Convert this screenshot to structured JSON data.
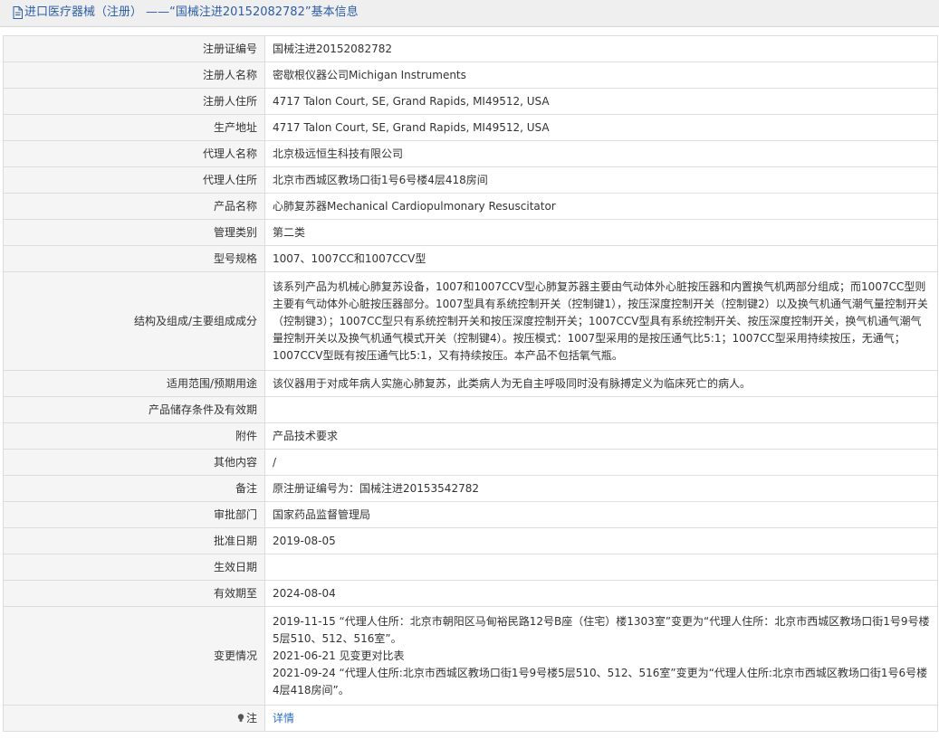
{
  "page": {
    "title": "进口医疗器械（注册） ——“国械注进20152082782”基本信息",
    "icon": "document-icon"
  },
  "rows": [
    {
      "key": "reg_no",
      "label": "注册证编号",
      "value": "国械注进20152082782"
    },
    {
      "key": "registrant",
      "label": "注册人名称",
      "value": "密歇根仪器公司Michigan Instruments"
    },
    {
      "key": "registrant_addr",
      "label": "注册人住所",
      "value": "4717 Talon Court, SE, Grand Rapids, MI49512, USA"
    },
    {
      "key": "production_addr",
      "label": "生产地址",
      "value": "4717 Talon Court, SE, Grand Rapids, MI49512, USA"
    },
    {
      "key": "agent",
      "label": "代理人名称",
      "value": "北京极远恒生科技有限公司"
    },
    {
      "key": "agent_addr",
      "label": "代理人住所",
      "value": "北京市西城区教场口街1号6号楼4层418房间"
    },
    {
      "key": "product_name",
      "label": "产品名称",
      "value": "心肺复苏器Mechanical Cardiopulmonary Resuscitator"
    },
    {
      "key": "category",
      "label": "管理类别",
      "value": "第二类"
    },
    {
      "key": "model",
      "label": "型号规格",
      "value": "1007、1007CC和1007CCV型"
    },
    {
      "key": "composition",
      "label": "结构及组成/主要组成成分",
      "value": "该系列产品为机械心肺复苏设备，1007和1007CCV型心肺复苏器主要由气动体外心脏按压器和内置换气机两部分组成；而1007CC型则主要有气动体外心脏按压器部分。1007型具有系统控制开关（控制键1），按压深度控制开关（控制键2）以及换气机通气潮气量控制开关（控制键3）；1007CC型只有系统控制开关和按压深度控制开关；1007CCV型具有系统控制开关、按压深度控制开关，换气机通气潮气量控制开关以及换气机通气模式开关（控制键4）。按压模式：1007型采用的是按压通气比5:1；1007CC型采用持续按压，无通气；1007CCV型既有按压通气比5:1，又有持续按压。本产品不包括氧气瓶。"
    },
    {
      "key": "intended_use",
      "label": "适用范围/预期用途",
      "value": "该仪器用于对成年病人实施心肺复苏，此类病人为无自主呼吸同时没有脉搏定义为临床死亡的病人。"
    },
    {
      "key": "storage",
      "label": "产品储存条件及有效期",
      "value": ""
    },
    {
      "key": "attachment",
      "label": "附件",
      "value": "产品技术要求"
    },
    {
      "key": "other",
      "label": "其他内容",
      "value": "/"
    },
    {
      "key": "remark",
      "label": "备注",
      "value": "原注册证编号为：国械注进20153542782"
    },
    {
      "key": "authority",
      "label": "审批部门",
      "value": "国家药品监督管理局"
    },
    {
      "key": "approval_date",
      "label": "批准日期",
      "value": "2019-08-05"
    },
    {
      "key": "effective_date",
      "label": "生效日期",
      "value": ""
    },
    {
      "key": "expiry_date",
      "label": "有效期至",
      "value": "2024-08-04"
    }
  ],
  "changes": {
    "label": "变更情况",
    "lines": [
      "2019-11-15 “代理人住所：北京市朝阳区马甸裕民路12号B座（住宅）楼1303室”变更为“代理人住所：北京市西城区教场口街1号9号楼5层510、512、516室”。",
      "2021-06-21 见变更对比表",
      "2021-09-24 “代理人住所:北京市西城区教场口街1号9号楼5层510、512、516室”变更为“代理人住所:北京市西城区教场口街1号6号楼4层418房间”。"
    ]
  },
  "note": {
    "label": "注",
    "icon": "lightbulb-icon",
    "link_text": "详情"
  },
  "colors": {
    "title": "#2d5ea6",
    "link": "#2d6fbf",
    "label_bg": "#f5f5f5",
    "border": "#dddddd"
  }
}
